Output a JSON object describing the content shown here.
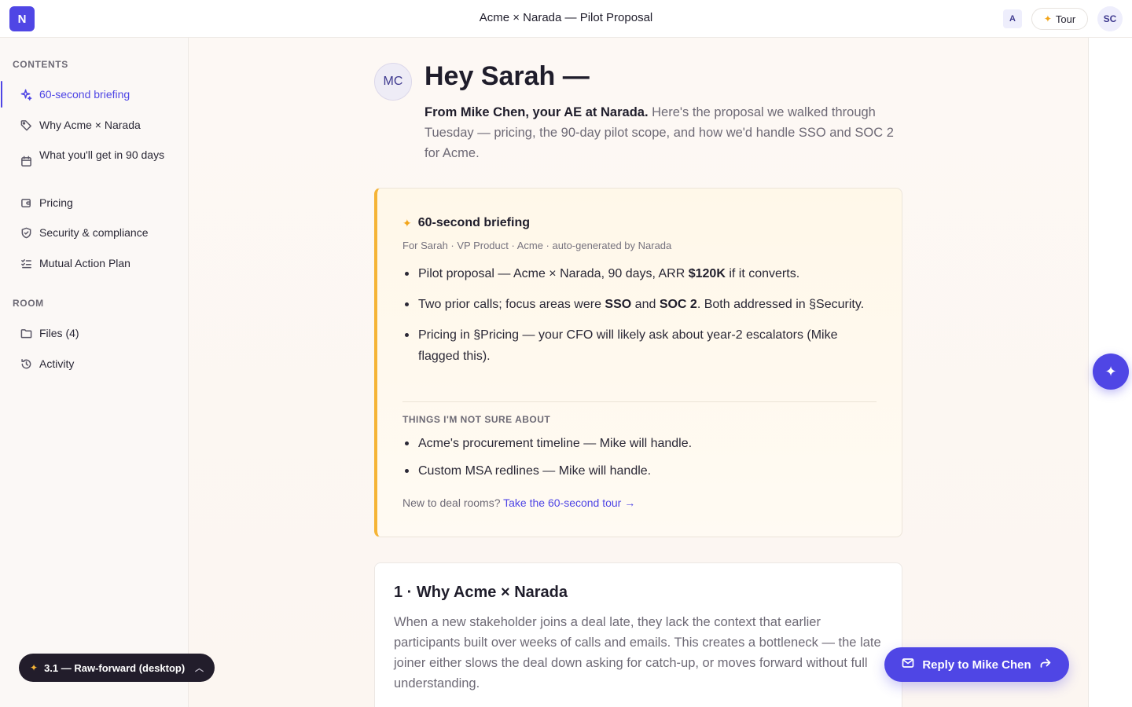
{
  "app": {
    "logo_letter": "N",
    "doc_title": "Acme × Narada — Pilot Proposal",
    "lang_label": "A",
    "tour_label": "Tour",
    "user_initials": "SC"
  },
  "sidebar": {
    "contents_heading": "CONTENTS",
    "contents": [
      {
        "label": "60-second briefing",
        "icon": "sparkle-icon",
        "active": true
      },
      {
        "label": "Why Acme × Narada",
        "icon": "tag-icon"
      },
      {
        "label": "What you'll get in 90 days",
        "icon": "calendar-icon"
      },
      {
        "label": "Pricing",
        "icon": "wallet-icon"
      },
      {
        "label": "Security & compliance",
        "icon": "shield-icon"
      },
      {
        "label": "Mutual Action Plan",
        "icon": "checklist-icon"
      }
    ],
    "room_heading": "ROOM",
    "room": [
      {
        "label": "Files (4)",
        "icon": "folder-icon"
      },
      {
        "label": "Activity",
        "icon": "history-icon"
      }
    ],
    "version_label": "3.1 — Raw-forward (desktop)"
  },
  "hero": {
    "avatar_initials": "MC",
    "greeting": "Hey Sarah —",
    "intro_lead": "From Mike Chen, your AE at Narada.",
    "intro_rest": " Here's the proposal we walked through Tuesday — pricing, the 90-day pilot scope, and how we'd handle SSO and SOC 2 for Acme."
  },
  "briefing": {
    "title": "60-second briefing",
    "subtitle": "For Sarah · VP Product · Acme · auto-generated by Narada",
    "bullets": [
      {
        "parts": [
          "Pilot proposal — Acme × Narada, 90 days, ARR ",
          "$120K",
          " if it converts."
        ]
      },
      {
        "parts": [
          "Two prior calls; focus areas were ",
          "SSO",
          " and ",
          "SOC 2",
          ". Both addressed in §Security."
        ]
      },
      {
        "parts": [
          "Pricing in §Pricing — your CFO will likely ask about year-2 escalators (Mike flagged this)."
        ]
      }
    ],
    "unsure_heading": "THINGS I'M NOT SURE ABOUT",
    "unsure": [
      "Acme's procurement timeline — Mike will handle.",
      "Custom MSA redlines — Mike will handle."
    ],
    "tour_prompt": "New to deal rooms? ",
    "tour_link": "Take the 60-second tour →"
  },
  "section1": {
    "title": "1 · Why Acme × Narada",
    "body": "When a new stakeholder joins a deal late, they lack the context that earlier participants built over weeks of calls and emails. This creates a bottleneck — the late joiner either slows the deal down asking for catch-up, or moves forward without full understanding."
  },
  "actions": {
    "reply_label": "Reply to Mike Chen"
  },
  "colors": {
    "accent": "#4f46e5",
    "highlight": "#f5b436"
  }
}
